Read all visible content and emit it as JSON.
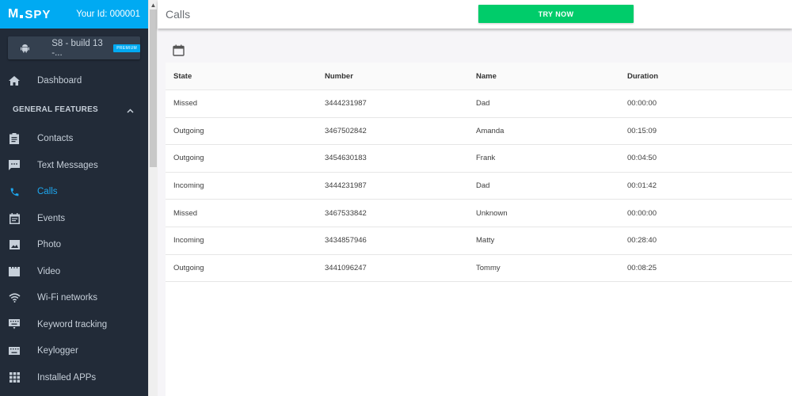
{
  "brand": {
    "logo_text": "SPY",
    "logo_prefix": "M",
    "user_id_label": "Your Id: 000001"
  },
  "device": {
    "name": "S8 - build 13 -...",
    "badge": "PREMIUM"
  },
  "nav": {
    "dashboard": "Dashboard",
    "section_title": "GENERAL FEATURES",
    "items": [
      {
        "label": "Contacts",
        "icon": "contacts-icon"
      },
      {
        "label": "Text Messages",
        "icon": "message-icon"
      },
      {
        "label": "Calls",
        "icon": "phone-icon",
        "active": true
      },
      {
        "label": "Events",
        "icon": "calendar-event-icon"
      },
      {
        "label": "Photo",
        "icon": "photo-icon"
      },
      {
        "label": "Video",
        "icon": "video-icon"
      },
      {
        "label": "Wi-Fi networks",
        "icon": "wifi-icon"
      },
      {
        "label": "Keyword tracking",
        "icon": "keyword-icon"
      },
      {
        "label": "Keylogger",
        "icon": "keyboard-icon"
      },
      {
        "label": "Installed APPs",
        "icon": "apps-grid-icon"
      }
    ]
  },
  "header": {
    "title": "Calls",
    "cta_label": "TRY NOW"
  },
  "colors": {
    "brand": "#00aaf2",
    "cta": "#00cc6a",
    "sidebar": "#222b38",
    "active": "#1ea7ef"
  },
  "table": {
    "columns": [
      "State",
      "Number",
      "Name",
      "Duration"
    ],
    "rows": [
      [
        "Missed",
        "3444231987",
        "Dad",
        "00:00:00"
      ],
      [
        "Outgoing",
        "3467502842",
        "Amanda",
        "00:15:09"
      ],
      [
        "Outgoing",
        "3454630183",
        "Frank",
        "00:04:50"
      ],
      [
        "Incoming",
        "3444231987",
        "Dad",
        "00:01:42"
      ],
      [
        "Missed",
        "3467533842",
        "Unknown",
        "00:00:00"
      ],
      [
        "Incoming",
        "3434857946",
        "Matty",
        "00:28:40"
      ],
      [
        "Outgoing",
        "3441096247",
        "Tommy",
        "00:08:25"
      ]
    ]
  }
}
